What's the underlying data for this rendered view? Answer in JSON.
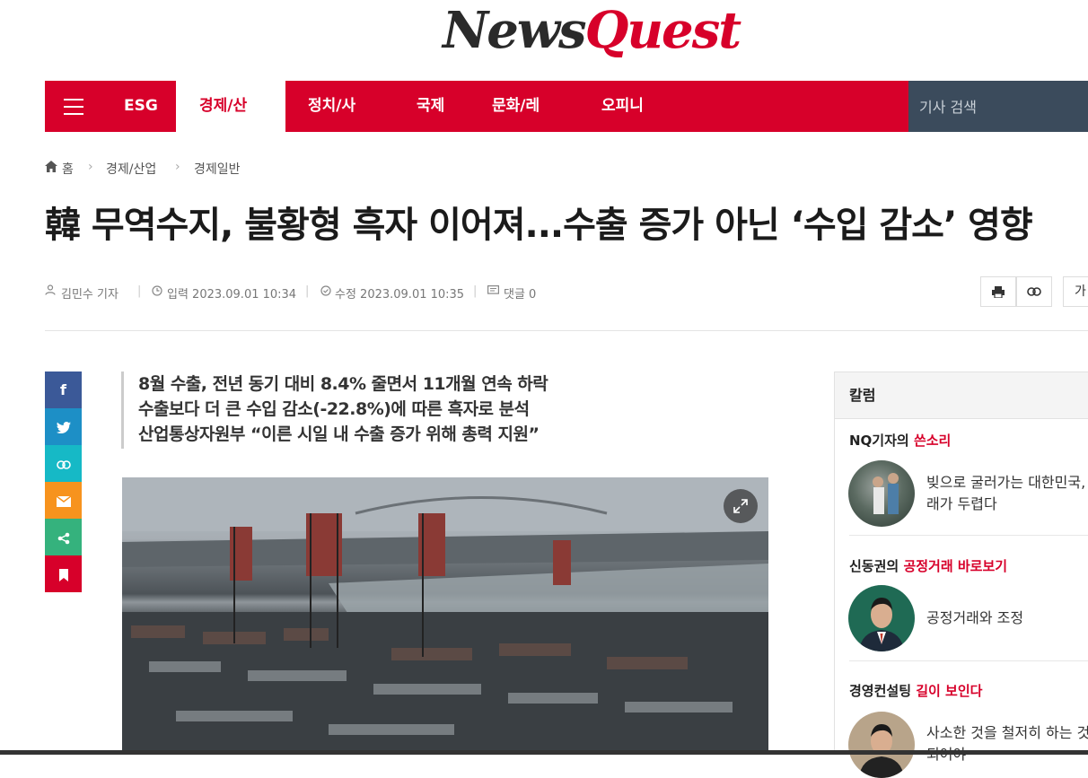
{
  "logo": {
    "part1": "News",
    "part2": "Quest"
  },
  "nav": {
    "menu_icon": "hamburger-icon",
    "items": [
      "ESG",
      "경제/산",
      "정치/사",
      "국제",
      "문화/레",
      "오피니"
    ],
    "search_placeholder": "기사 검색"
  },
  "breadcrumb": {
    "home": "홈",
    "level1": "경제/산업",
    "level2": "경제일반"
  },
  "article": {
    "title": "韓 무역수지, 불황형 흑자 이어져...수출 증가 아닌 ‘수입 감소’ 영향",
    "author": "김민수 기자",
    "published": "입력 2023.09.01 10:34",
    "modified": "수정 2023.09.01 10:35",
    "comments": "댓글 0",
    "summary": [
      "8월 수출, 전년 동기 대비 8.4% 줄면서 11개월 연속 하락",
      "수출보다 더 큰 수입 감소(-22.8%)에 따른 흑자로 분석",
      "산업통상자원부 “이른 시일 내 수출 증가 위해 총력 지원”"
    ]
  },
  "tools": {
    "print_icon": "print-icon",
    "link_icon": "link-icon",
    "font_label": "가"
  },
  "share": [
    "facebook-icon",
    "twitter-icon",
    "link-icon",
    "email-icon",
    "share-icon",
    "bookmark-icon"
  ],
  "sidebar": {
    "heading": "칼럼",
    "columns": [
      {
        "prefix": "NQ기자의 ",
        "accent": "쓴소리",
        "text1": "빚으로 굴러가는 대한민국,",
        "text2": "래가 두렵다"
      },
      {
        "prefix": "신동권의 ",
        "accent": "공정거래 바로보기",
        "text1": "공정거래와 조정",
        "text2": ""
      },
      {
        "prefix": "경영컨설팅 ",
        "accent": "길이 보인다",
        "text1": "사소한 것을 철저히 하는 것",
        "text2": "되어야"
      }
    ]
  },
  "colors": {
    "brand_red": "#d7002a",
    "search_bg": "#3b4b5c",
    "facebook": "#3b5998",
    "twitter": "#1d8fc6",
    "link": "#16b9c6",
    "email": "#f7931e",
    "share": "#35b27d",
    "bookmark": "#d7002a"
  }
}
